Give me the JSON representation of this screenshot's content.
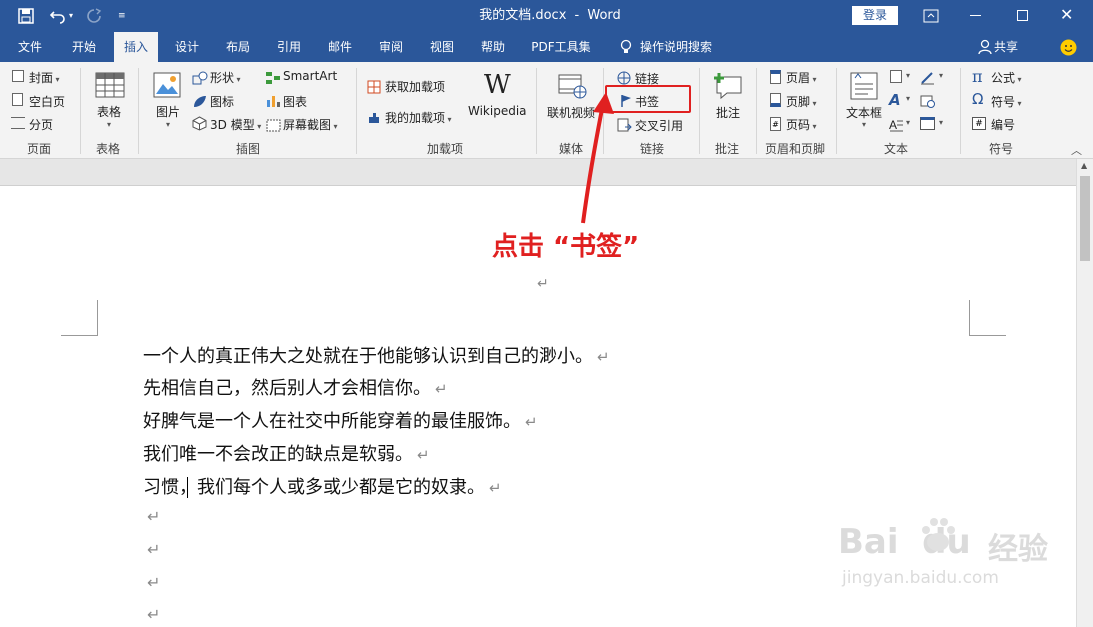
{
  "titlebar": {
    "doc_title": "我的文档.docx",
    "separator": "-",
    "app_name": "Word",
    "login_label": "登录"
  },
  "tabs": {
    "file": "文件",
    "home": "开始",
    "insert": "插入",
    "design": "设计",
    "layout": "布局",
    "references": "引用",
    "mailings": "邮件",
    "review": "审阅",
    "view": "视图",
    "help": "帮助",
    "pdf": "PDF工具集",
    "tell_me": "操作说明搜索",
    "share": "共享"
  },
  "ribbon": {
    "pages": {
      "cover": "封面",
      "blank": "空白页",
      "break": "分页",
      "group": "页面"
    },
    "tables": {
      "table": "表格",
      "group": "表格"
    },
    "illustrations": {
      "pictures": "图片",
      "shapes": "形状",
      "icons": "图标",
      "model3d": "3D 模型",
      "smartart": "SmartArt",
      "chart": "图表",
      "screenshot": "屏幕截图",
      "group": "插图"
    },
    "addins": {
      "get": "获取加载项",
      "my": "我的加载项",
      "wikipedia": "Wikipedia",
      "wiki_logo": "W",
      "group": "加载项"
    },
    "media": {
      "online_video": "联机视频",
      "group": "媒体"
    },
    "links": {
      "link": "链接",
      "bookmark": "书签",
      "crossref": "交叉引用",
      "group": "链接"
    },
    "comments": {
      "comment": "批注",
      "group": "批注"
    },
    "headerfooter": {
      "header": "页眉",
      "footer": "页脚",
      "pagenum": "页码",
      "group": "页眉和页脚"
    },
    "text": {
      "textbox": "文本框",
      "group": "文本"
    },
    "symbols": {
      "equation": "公式",
      "symbol": "符号",
      "number": "编号",
      "pi": "π",
      "omega": "Ω",
      "group": "符号"
    }
  },
  "annotation": {
    "text": "点击 “书签”"
  },
  "document": {
    "paragraphs": [
      "一个人的真正伟大之处就在于他能够认识到自己的渺小。",
      "先相信自己，然后别人才会相信你。",
      "好脾气是一个人在社交中所能穿着的最佳服饰。",
      "我们唯一不会改正的缺点是软弱。",
      "习惯，我们每个人或多或少都是它的奴隶。"
    ],
    "pilcrow": "↵"
  },
  "watermark": {
    "brand": "Bai  du",
    "cn": "经验",
    "url": "jingyan.baidu.com"
  },
  "colors": {
    "accent": "#2b579a",
    "highlight": "#e02020"
  }
}
